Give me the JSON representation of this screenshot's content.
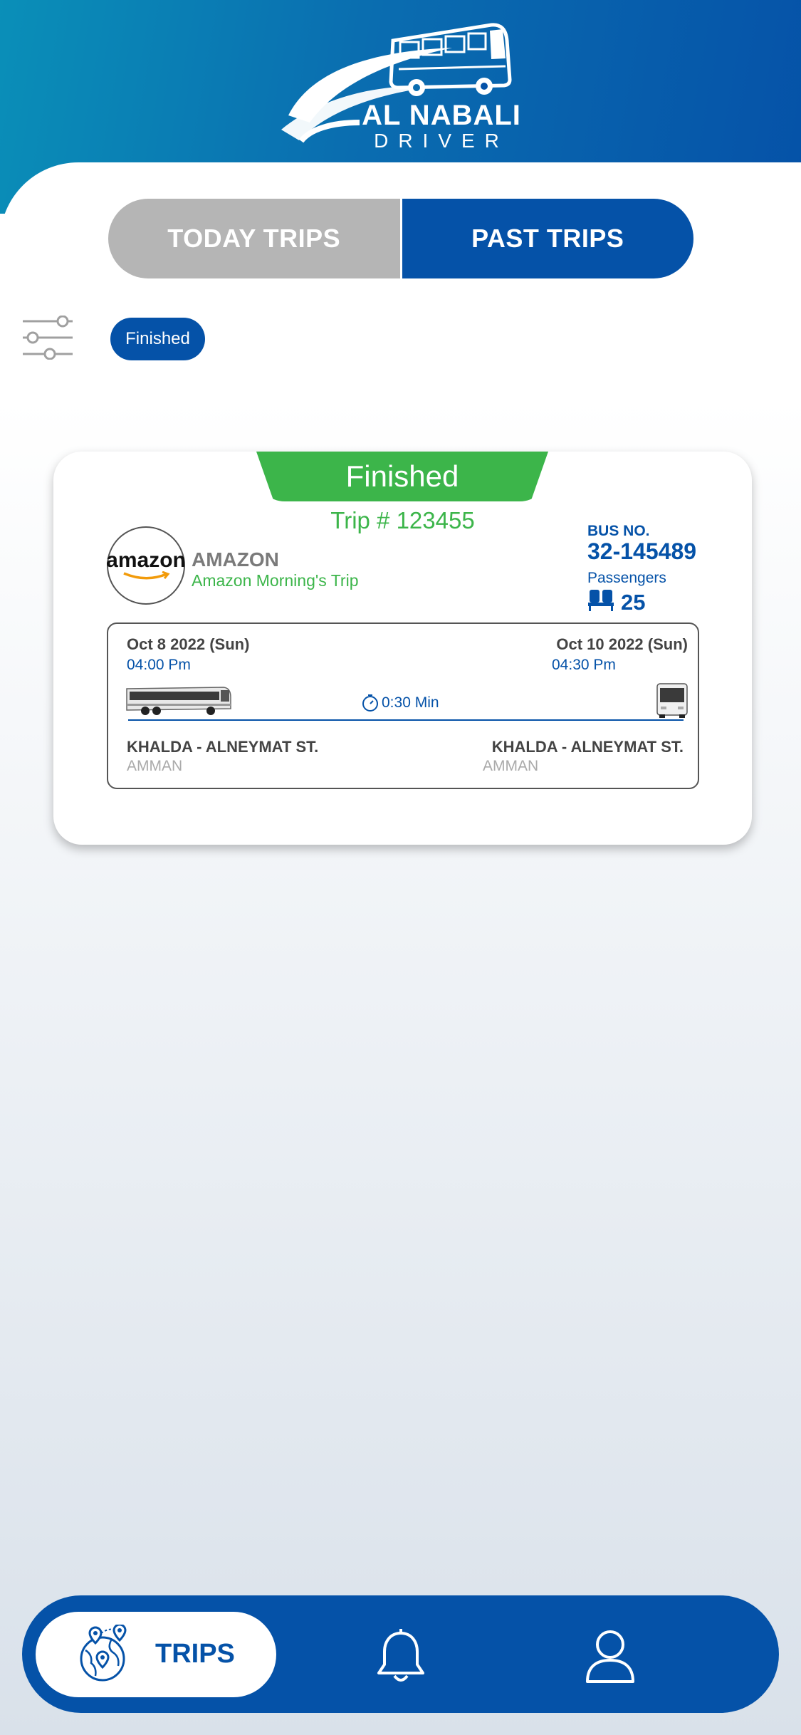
{
  "brand": {
    "title": "AL NABALI",
    "subtitle": "DRIVER"
  },
  "tabs": {
    "today": "TODAY TRIPS",
    "past": "PAST TRIPS",
    "active": "past"
  },
  "filter": {
    "chip": "Finished"
  },
  "trip": {
    "status": "Finished",
    "number": "Trip # 123455",
    "company_logo_text": "amazon",
    "company_name": "AMAZON",
    "trip_name": "Amazon Morning's Trip",
    "bus_label": "BUS NO.",
    "bus_number": "32-145489",
    "passengers_label": "Passengers",
    "passengers": "25",
    "departure": {
      "date": "Oct 8 2022 (Sun)",
      "time": "04:00 Pm",
      "place": "KHALDA - ALNEYMAT ST.",
      "city": "AMMAN"
    },
    "arrival": {
      "date": "Oct 10 2022 (Sun)",
      "time": "04:30 Pm",
      "place": "KHALDA - ALNEYMAT ST.",
      "city": "AMMAN"
    },
    "duration": "0:30 Min"
  },
  "nav": {
    "trips": "TRIPS",
    "active": "trips"
  },
  "colors": {
    "primary": "#0552a8",
    "success": "#3cb54a",
    "inactive": "#b5b5b5"
  },
  "icons": [
    "bus-logo-icon",
    "filter-sliders-icon",
    "seat-icon",
    "clock-icon",
    "globe-map-icon",
    "bell-icon",
    "user-icon"
  ]
}
